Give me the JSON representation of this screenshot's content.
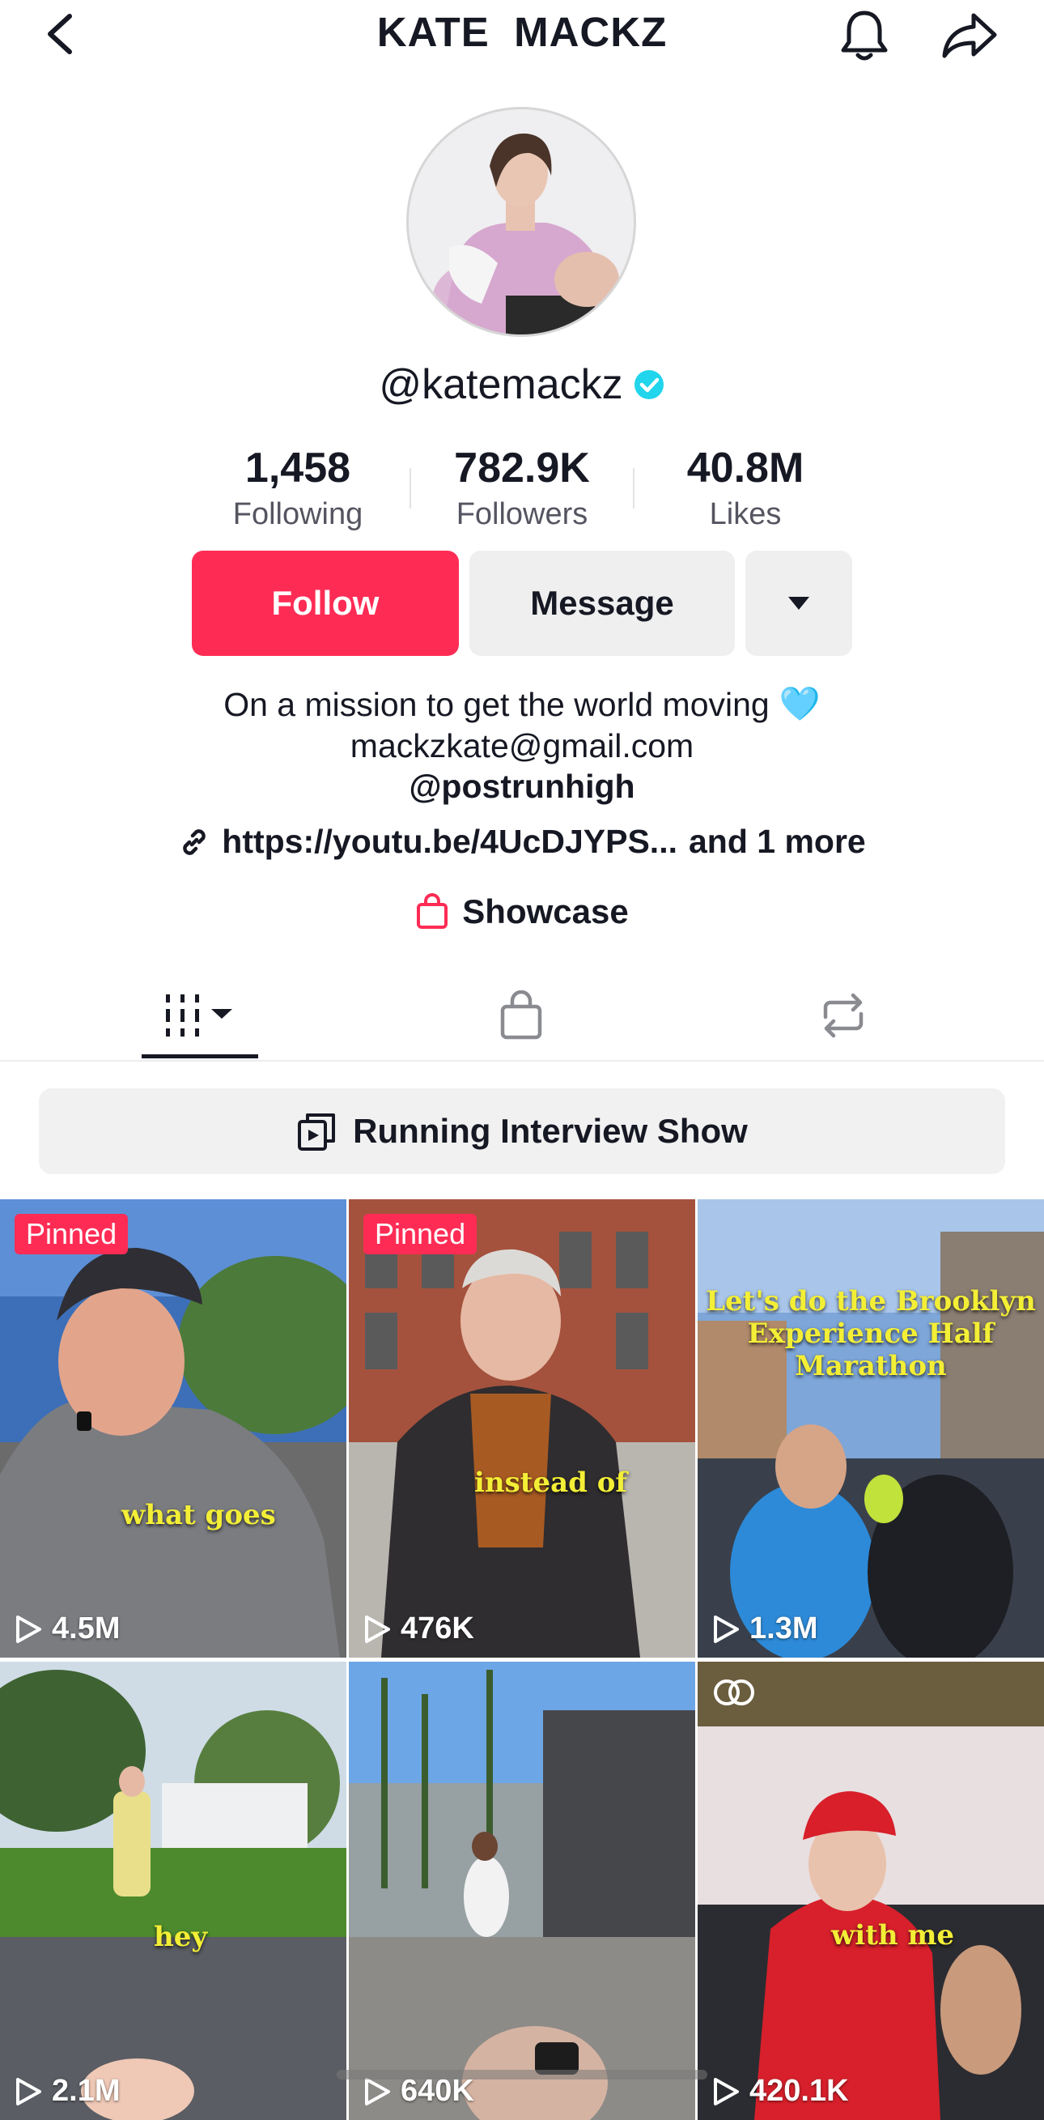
{
  "header": {
    "title": "KATE  MACKZ"
  },
  "profile": {
    "username": "@katemackz",
    "verified": true
  },
  "stats": [
    {
      "value": "1,458",
      "label": "Following"
    },
    {
      "value": "782.9K",
      "label": "Followers"
    },
    {
      "value": "40.8M",
      "label": "Likes"
    }
  ],
  "actions": {
    "follow_label": "Follow",
    "message_label": "Message"
  },
  "bio": {
    "line1": "On a mission to get the world moving",
    "line1_emoji": "🩵",
    "line2": "mackzkate@gmail.com",
    "line3": "@postrunhigh",
    "link": "https://youtu.be/4UcDJYPS...",
    "link_more": "and 1 more",
    "showcase": "Showcase"
  },
  "tabs": [
    "videos",
    "shop",
    "reposts"
  ],
  "playlist": {
    "label": "Running Interview Show"
  },
  "videos": [
    {
      "pinned": "Pinned",
      "views": "4.5M",
      "caption": "what goes"
    },
    {
      "pinned": "Pinned",
      "views": "476K",
      "caption": "instead of"
    },
    {
      "pinned": "",
      "views": "1.3M",
      "caption": "Let's do the Brooklyn Experience Half Marathon"
    },
    {
      "pinned": "",
      "views": "2.1M",
      "caption": "hey"
    },
    {
      "pinned": "",
      "views": "640K",
      "caption": ""
    },
    {
      "pinned": "",
      "views": "420.1K",
      "caption": "with me"
    }
  ],
  "colors": {
    "accent": "#fe2c55",
    "verified": "#20d5ec",
    "text": "#161823",
    "secondary_text": "#545560"
  }
}
